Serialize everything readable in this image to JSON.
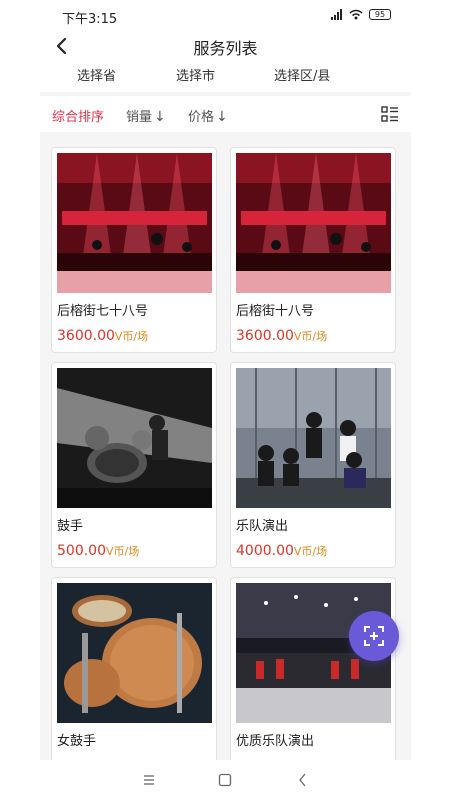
{
  "status_bar": {
    "time": "下午3:15",
    "battery": "95"
  },
  "header": {
    "title": "服务列表"
  },
  "region_filters": {
    "province": "选择省",
    "city": "选择市",
    "district": "选择区/县"
  },
  "sort_bar": {
    "composite": "综合排序",
    "sales": "销量",
    "price": "价格",
    "down_arrow": "↓"
  },
  "items": [
    {
      "name": "后榕街七十八号",
      "price": "3600.00",
      "unit": "V币/场",
      "image": "stage-red-concert"
    },
    {
      "name": "后榕街十八号",
      "price": "3600.00",
      "unit": "V币/场",
      "image": "stage-red-concert"
    },
    {
      "name": "鼓手",
      "price": "500.00",
      "unit": "V币/场",
      "image": "drummer-bw"
    },
    {
      "name": "乐队演出",
      "price": "4000.00",
      "unit": "V币/场",
      "image": "band-group-photo"
    },
    {
      "name": "女鼓手",
      "price": "",
      "unit": "",
      "image": "drum-kit-closeup"
    },
    {
      "name": "优质乐队演出",
      "price": "",
      "unit": "",
      "image": "orchestra-stage"
    }
  ],
  "colors": {
    "accent": "#e0314b",
    "price": "#d8362a",
    "unit": "#e08a1a",
    "fab": "#6a5ad8"
  },
  "icons": {
    "back": "chevron-left-icon",
    "list_view": "list-view-icon",
    "fab": "scan-plus-icon",
    "nav_menu": "menu-icon",
    "nav_home": "square-home-icon",
    "nav_back": "triangle-back-icon"
  }
}
